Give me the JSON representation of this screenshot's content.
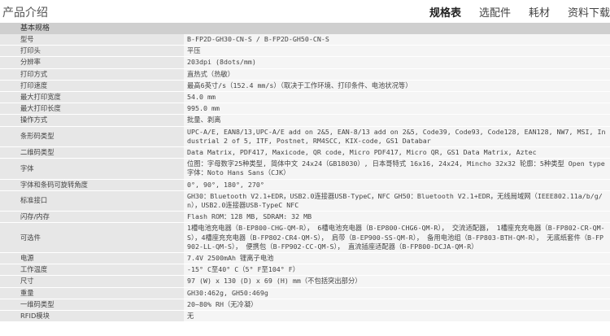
{
  "page": {
    "title": "产品介绍",
    "tabs": [
      {
        "label": "规格表",
        "active": true
      },
      {
        "label": "选配件",
        "active": false
      },
      {
        "label": "耗材",
        "active": false
      },
      {
        "label": "资料下载",
        "active": false
      }
    ]
  },
  "spec": {
    "section": "基本规格",
    "rows": [
      {
        "k": "型号",
        "v": "B-FP2D-GH30-CN-S / B-FP2D-GH50-CN-S"
      },
      {
        "k": "打印头",
        "v": "平压"
      },
      {
        "k": "分辨率",
        "v": "203dpi (8dots/mm)"
      },
      {
        "k": "打印方式",
        "v": "直热式（热敏）"
      },
      {
        "k": "打印速度",
        "v": "最高6英寸/s（152.4 mm/s）（取决于工作环境、打印条件、电池状况等）"
      },
      {
        "k": "最大打印宽度",
        "v": "54.0 mm"
      },
      {
        "k": "最大打印长度",
        "v": "995.0 mm"
      },
      {
        "k": "操作方式",
        "v": "批量、剥离"
      },
      {
        "k": "条形码类型",
        "v": "UPC-A/E, EAN8/13,UPC-A/E add on 2&5, EAN-8/13 add on 2&5, Code39, Code93, Code128, EAN128, NW7, MSI, Industrial 2 of 5, ITF, Postnet, RM4SCC, KIX-code, GS1 Databar"
      },
      {
        "k": "二维码类型",
        "v": "Data Matrix, PDF417, Maxicode, QR code, Micro PDF417, Micro QR, GS1 Data Matrix, Aztec"
      },
      {
        "k": "字体",
        "v": "位图：字母数字25种类型, 简体中文 24x24（GB18030）, 日本哥特式 16x16, 24x24, Mincho 32x32 轮廓：5种类型 Open type字体：Noto Hans Sans（CJK）"
      },
      {
        "k": "字体和条码可旋转角度",
        "v": "0°, 90°, 180°, 270°"
      },
      {
        "k": "标准接口",
        "v": "GH30：Bluetooth V2.1+EDR，USB2.0连接器USB-TypeC，NFC GH50：Bluetooth V2.1+EDR，无线局域网（IEEE802.11a/b/g/n），USB2.0连接器USB-TypeC NFC"
      },
      {
        "k": "闪存/内存",
        "v": "Flash ROM：128 MB, SDRAM: 32 MB"
      },
      {
        "k": "可选件",
        "v": "1槽电池充电器（B-EP800-CHG-QM-R）， 6槽电池充电器（B-EP800-CHG6-QM-R）， 交流适配器， 1槽座充充电器（B-FP802-CR-QM-S），4槽座充充电器（B-FP802-CR4-QM-S）， 肩带（B-EP900-SS-QM-R）， 备用电池组（B-FP803-BTH-QM-R）， 无底纸套件（B-FP902-LL-QM-S）， 便携包（B-FP902-CC-QM-S）， 直流插座适配器（B-FP800-DCJA-QM-R）"
      },
      {
        "k": "电源",
        "v": "7.4V 2500mAh 锂离子电池"
      },
      {
        "k": "工作温度",
        "v": "-15° C至40° C（5° F至104° F）"
      },
      {
        "k": "尺寸",
        "v": "97 (W) x 130 (D) x 69 (H) mm（不包括突出部分）"
      },
      {
        "k": "重量",
        "v": "GH30:462g, GH50:469g"
      },
      {
        "k": "一维码类型",
        "v": "20~80% RH（无冷凝）"
      },
      {
        "k": "RFID模块",
        "v": "无"
      }
    ]
  }
}
